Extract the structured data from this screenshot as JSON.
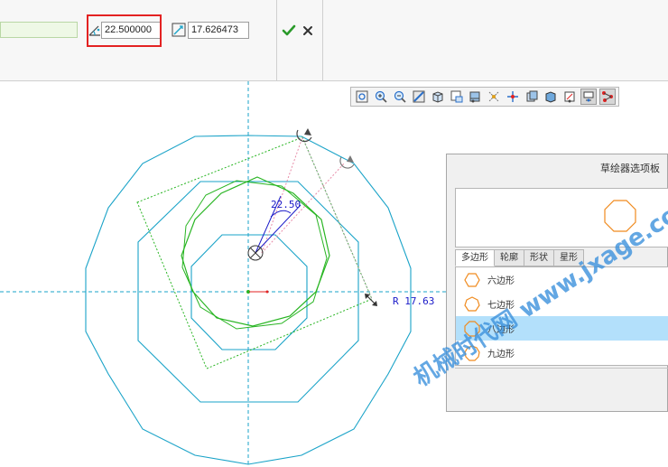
{
  "dashboard": {
    "angle_value": "22.500000",
    "radius_value": "17.626473"
  },
  "sketch": {
    "angle_dimension": "22.50",
    "radius_dimension": "R 17.63"
  },
  "palette": {
    "title": "草绘器选项板",
    "tabs": [
      "多边形",
      "轮廓",
      "形状",
      "星形"
    ],
    "active_tab": 0,
    "items": [
      {
        "label": "六边形",
        "icon": "hexagon-icon"
      },
      {
        "label": "七边形",
        "icon": "heptagon-icon"
      },
      {
        "label": "八边形",
        "icon": "octagon-icon"
      },
      {
        "label": "九边形",
        "icon": "nonagon-icon"
      }
    ],
    "selected_item": 2,
    "preview_shape": "octagon-icon"
  },
  "view_toolbar_icons": [
    "refit-icon",
    "zoom-in-icon",
    "zoom-out-icon",
    "repaint-icon",
    "saved-orientations-icon",
    "named-views-icon",
    "display-style-icon",
    "datum-display-icon",
    "spin-center-icon",
    "annotation-display-icon",
    "view-manager-icon",
    "sketch-view-icon",
    "sketcher-display-icon",
    "grid-display-icon"
  ],
  "watermark": "机械时代网 www.jxage.com",
  "colors": {
    "highlight": "#e32222",
    "cyan_geometry": "#1aa3c8",
    "green_geometry": "#29b523",
    "dimension_blue": "#1a1ac8",
    "palette_selection": "#b3e0fb",
    "shape_orange": "#f08a1d"
  }
}
